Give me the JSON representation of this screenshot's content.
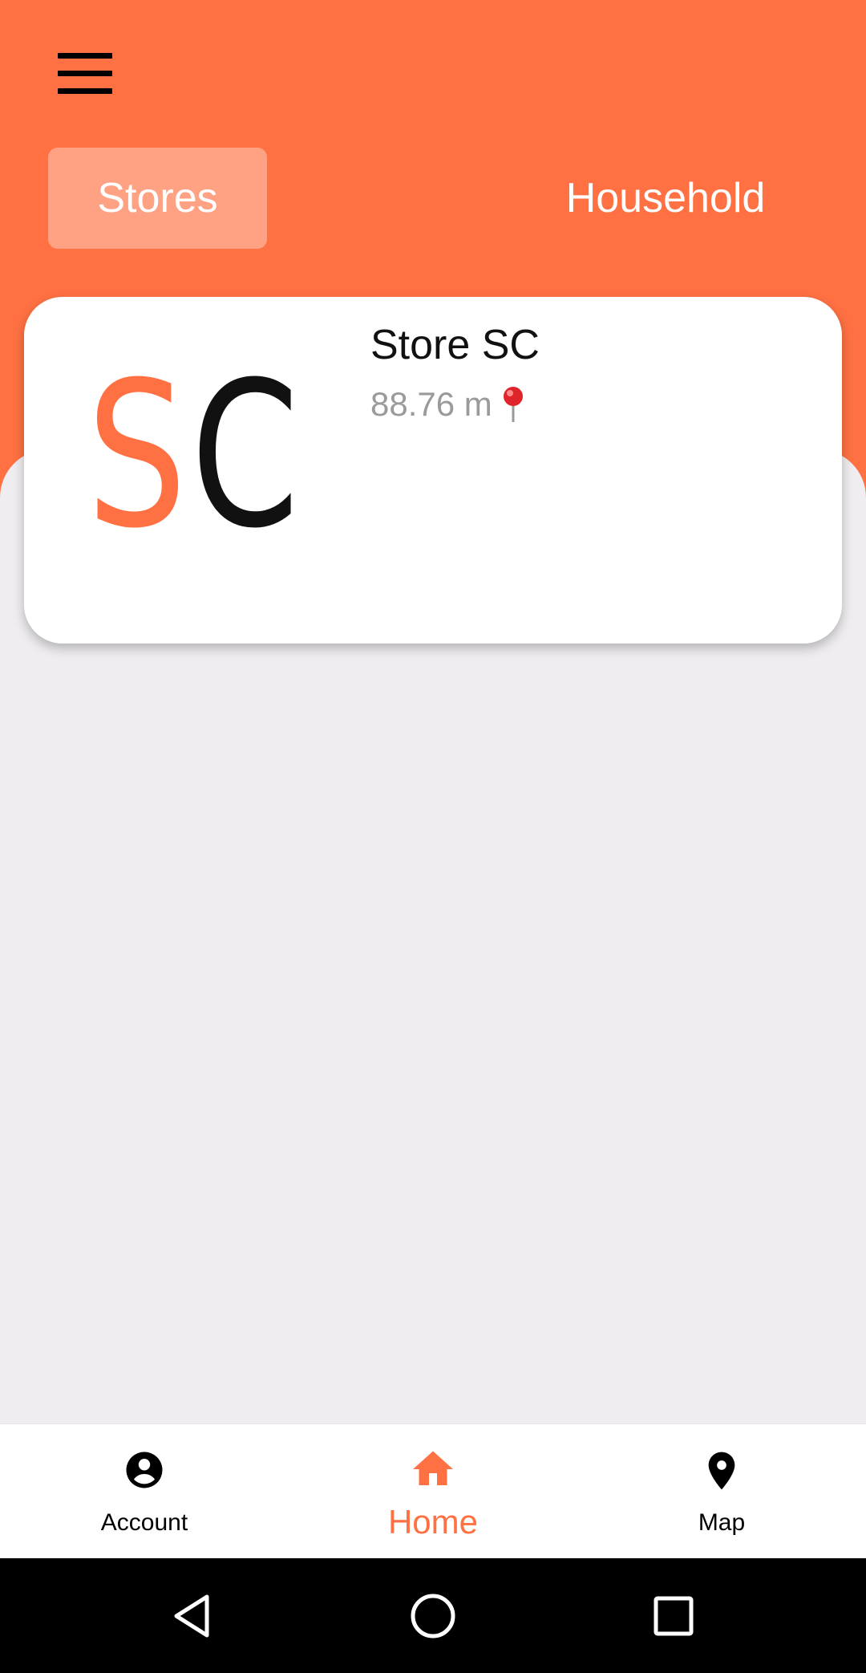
{
  "header": {
    "tabs": [
      {
        "label": "Stores",
        "active": true
      },
      {
        "label": "Household",
        "active": false
      }
    ]
  },
  "stores": [
    {
      "logo_text": [
        "S",
        "C"
      ],
      "logo_colors": [
        "#ff7143",
        "#111111"
      ],
      "name": "Store SC",
      "distance": "88.76 m"
    }
  ],
  "bottom_nav": {
    "items": [
      {
        "label": "Account",
        "icon": "account-circle-icon"
      },
      {
        "label": "Home",
        "icon": "home-icon",
        "active": true
      },
      {
        "label": "Map",
        "icon": "map-pin-icon"
      }
    ]
  },
  "colors": {
    "accent": "#ff7143",
    "background": "#efedf0"
  }
}
